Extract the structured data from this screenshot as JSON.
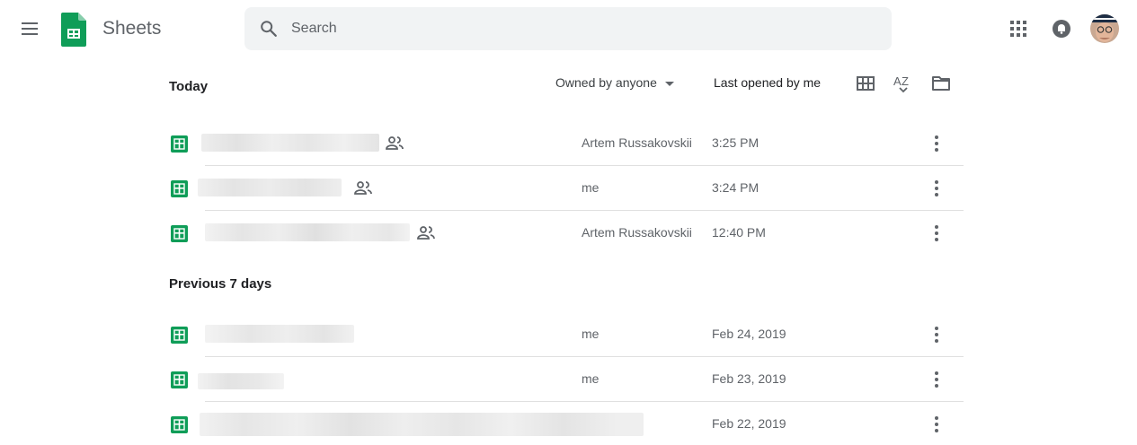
{
  "app": {
    "title": "Sheets"
  },
  "search": {
    "placeholder": "Search",
    "value": ""
  },
  "toolbar": {
    "owner_filter": "Owned by anyone",
    "sort_label": "Last opened by me",
    "grid_view_icon": "grid-view-icon",
    "sort_icon": "sort-az-icon",
    "folder_icon": "folder-icon"
  },
  "sections": [
    {
      "title": "Today",
      "files": [
        {
          "owner": "Artem Russakovskii",
          "date": "3:25 PM",
          "shared": true,
          "name_hidden": true
        },
        {
          "owner": "me",
          "date": "3:24 PM",
          "shared": true,
          "name_hidden": true
        },
        {
          "owner": "Artem Russakovskii",
          "date": "12:40 PM",
          "shared": true,
          "name_hidden": true
        }
      ]
    },
    {
      "title": "Previous 7 days",
      "files": [
        {
          "owner": "me",
          "date": "Feb 24, 2019",
          "shared": false,
          "name_hidden": true
        },
        {
          "owner": "me",
          "date": "Feb 23, 2019",
          "shared": false,
          "name_hidden": true
        },
        {
          "owner": "",
          "date": "Feb 22, 2019",
          "shared": false,
          "name_hidden": true
        }
      ]
    }
  ],
  "colors": {
    "sheets_green": "#0f9d58",
    "text_primary": "#202124",
    "text_secondary": "#5f6368",
    "divider": "#e0e0e0",
    "search_bg": "#f1f3f4"
  }
}
